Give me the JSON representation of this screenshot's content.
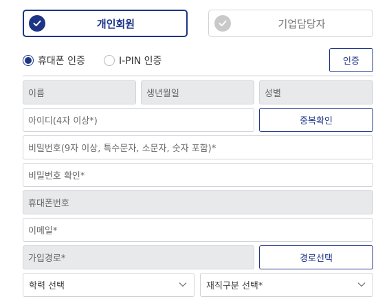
{
  "member_type": {
    "personal_label": "개인회원",
    "corporate_label": "기업담당자",
    "selected": "personal"
  },
  "auth": {
    "options": [
      "휴대폰 인증",
      "I-PIN 인증"
    ],
    "selected": "휴대폰 인증",
    "button_label": "인증"
  },
  "form": {
    "name": "이름",
    "birth": "생년월일",
    "gender": "성별",
    "user_id_placeholder": "아이디(4자 이상*)",
    "duplicate_check_label": "중복확인",
    "password_placeholder": "비밀번호(9자 이상, 특수문자, 소문자, 숫자 포함)*",
    "password_confirm_placeholder": "비밀번호 확인*",
    "phone": "휴대폰번호",
    "email_placeholder": "이메일*",
    "join_path": "가입경로*",
    "path_select_label": "경로선택",
    "education_select": "학력 선택",
    "employment_select": "재직구분 선택*"
  },
  "colors": {
    "accent": "#1d3487",
    "readonly_bg": "#e8e9eb",
    "border": "#cfd3d8"
  }
}
